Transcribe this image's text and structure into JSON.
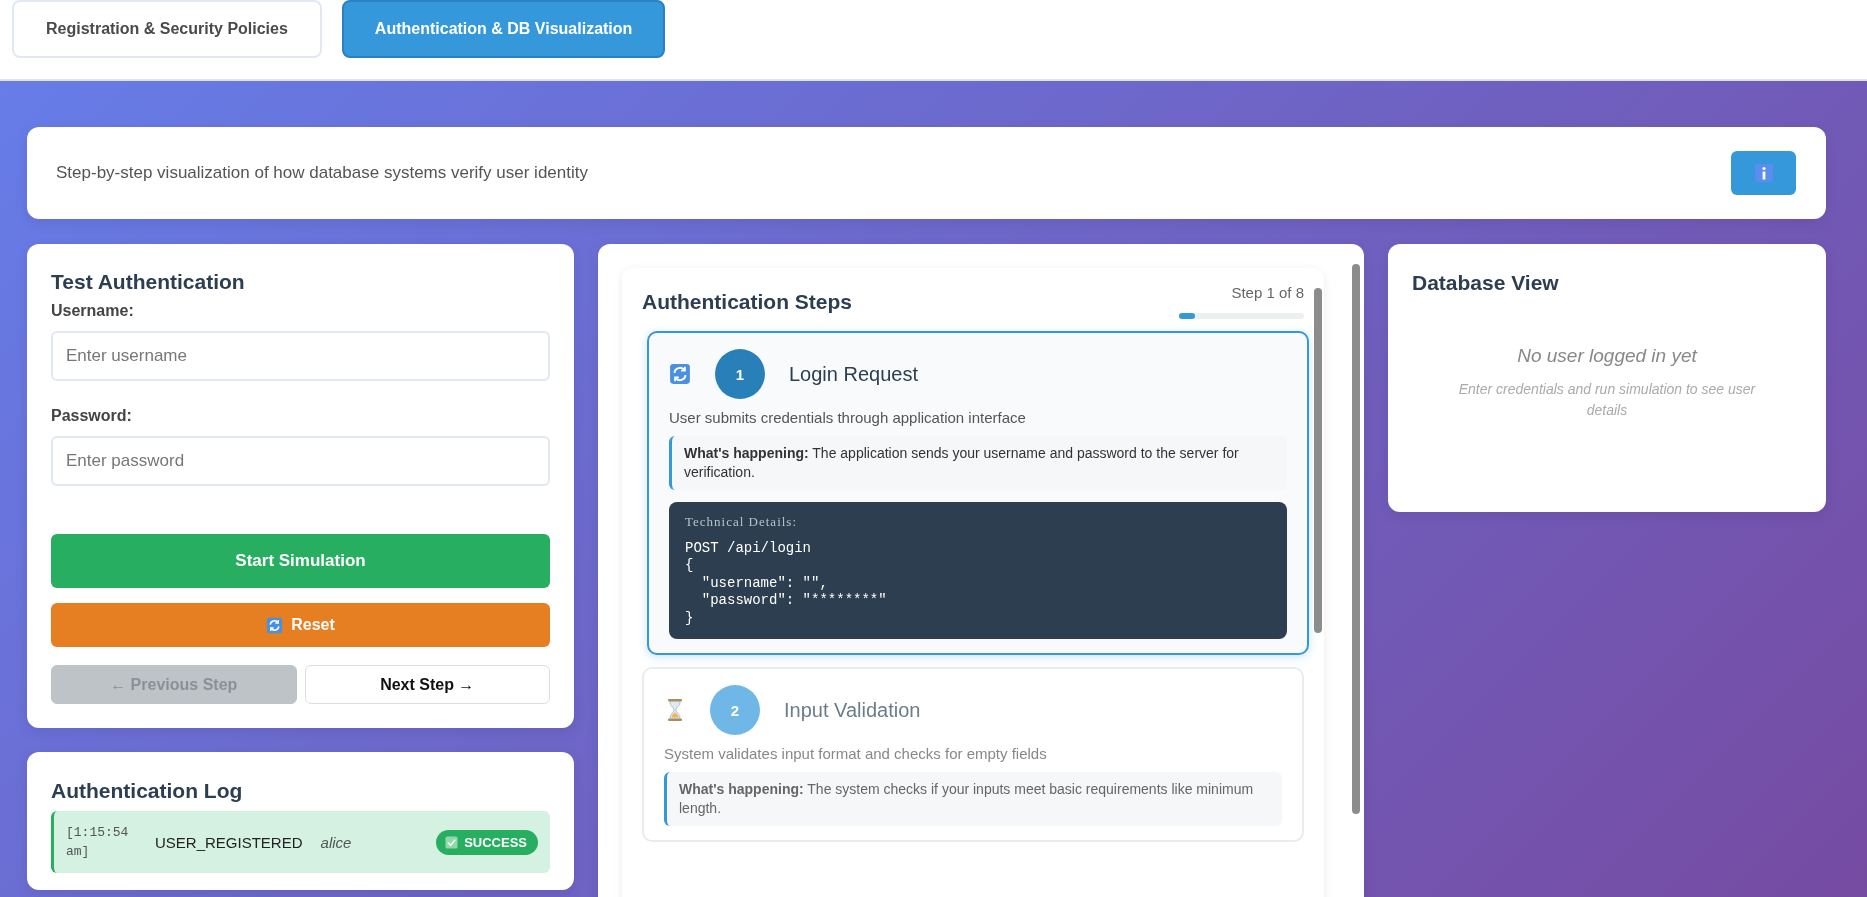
{
  "tabs": [
    {
      "label": "Registration & Security Policies",
      "selected": false
    },
    {
      "label": "Authentication & DB Visualization",
      "selected": true
    }
  ],
  "intro": {
    "text": "Step-by-step visualization of how database systems verify user identity"
  },
  "test_panel": {
    "title": "Test Authentication",
    "fields": [
      {
        "label": "Username:",
        "placeholder": "Enter username"
      },
      {
        "label": "Password:",
        "placeholder": "Enter password"
      }
    ],
    "start_button": "Start Simulation",
    "reset_button": "Reset",
    "nav_buttons": [
      {
        "label": "← Previous Step",
        "disabled": true
      },
      {
        "label": "Next Step →",
        "disabled": false
      }
    ]
  },
  "log": {
    "title": "Authentication Log",
    "entries": [
      {
        "time": "[1:15:54 am]",
        "event": "USER_REGISTERED",
        "user": "alice",
        "status": "SUCCESS",
        "kind": "success"
      }
    ]
  },
  "steps_panel": {
    "title": "Authentication Steps",
    "counter": "Step 1 of 8",
    "level": 0.125,
    "steps": [
      {
        "number": "1",
        "title": "Login Request",
        "kind": "active",
        "selected": true,
        "description": "User submits credentials through application interface",
        "explanation": "**What's happening:** The application sends your username and password to the server for verification.",
        "details_title": "Technical Details:",
        "details_code": "POST /api/login\n{\n  \"username\": \"\",\n  \"password\": \"********\"\n}"
      },
      {
        "number": "2",
        "title": "Input Validation",
        "kind": "pending",
        "selected": false,
        "description": "System validates input format and checks for empty fields",
        "explanation": "**What's happening:** The system checks if your inputs meet basic requirements like minimum length."
      }
    ]
  },
  "database_view": {
    "title": "Database View",
    "empty_title": "No user logged in yet",
    "empty_hint": "Enter credentials and run simulation to see user details"
  }
}
